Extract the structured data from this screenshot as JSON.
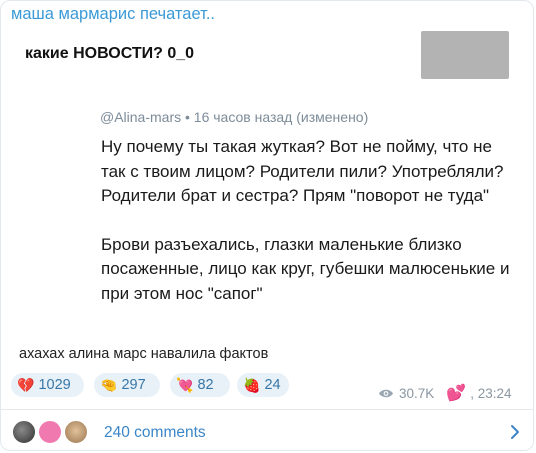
{
  "channel": {
    "title": "маша мармарис печатает.."
  },
  "repost": {
    "news_title": "какие НОВОСТИ? 0_0",
    "meta": "@Alina-mars • 16 часов назад (изменено)",
    "paragraphs": [
      "Ну почему ты такая жуткая? Вот не пойму, что не так с твоим лицом? Родители пили? Употребляли? Родители брат и сестра? Прям \"поворот не туда\"",
      "Брови разъехались, глазки маленькие близко посаженные, лицо как круг, губешки малюсенькие и при этом нос \"сапог\""
    ]
  },
  "caption": "ахахах алина марс навалила фактов",
  "reactions": [
    {
      "emoji": "💔",
      "icon": "broken-heart-icon",
      "count": "1029"
    },
    {
      "emoji": "🤏",
      "icon": "pinching-hand-icon",
      "count": "297"
    },
    {
      "emoji": "💘",
      "icon": "heart-arrow-icon",
      "count": "82"
    },
    {
      "emoji": "🍓",
      "icon": "strawberry-icon",
      "count": "24"
    }
  ],
  "stats": {
    "views": "30.7K",
    "reaction_emoji": "💕",
    "time": ", 23:24"
  },
  "comments": {
    "label": "240 comments"
  },
  "colors": {
    "accent": "#3b9ad6",
    "pill_bg": "#e9f1f8",
    "muted": "#8a97a3"
  }
}
